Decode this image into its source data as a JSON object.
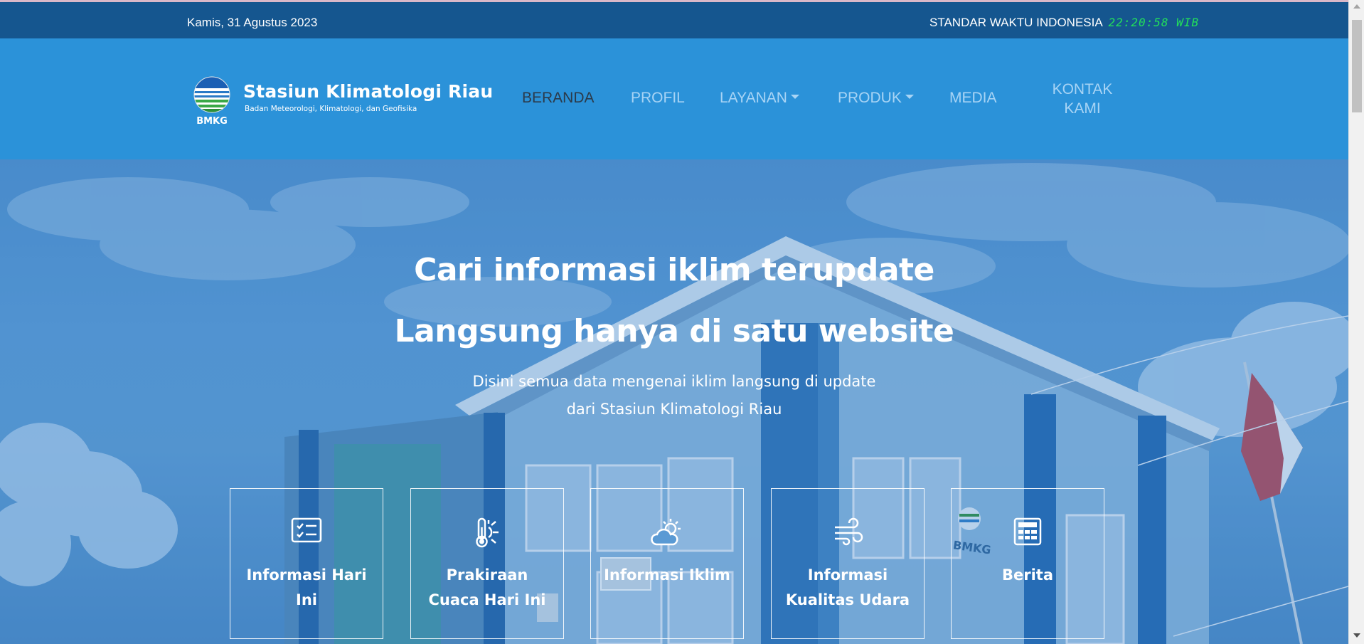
{
  "topbar": {
    "date": "Kamis, 31 Agustus 2023",
    "time_label": "STANDAR WAKTU INDONESIA",
    "clock": "22:20:58 WIB"
  },
  "brand": {
    "logo_text": "BMKG",
    "title": "Stasiun Klimatologi Riau",
    "subtitle": "Badan Meteorologi, Klimatologi, dan Geofisika"
  },
  "nav": {
    "beranda": "BERANDA",
    "profil": "PROFIL",
    "layanan": "LAYANAN",
    "produk": "PRODUK",
    "media": "MEDIA",
    "kontak_line1": "KONTAK",
    "kontak_line2": "KAMI"
  },
  "hero": {
    "title_line1": "Cari informasi iklim terupdate",
    "title_line2": "Langsung hanya di satu website",
    "sub_line1": "Disini semua data mengenai iklim langsung di update",
    "sub_line2": "dari Stasiun Klimatologi Riau",
    "background_building_sign": "BMKG"
  },
  "cards": [
    {
      "line1": "Informasi Hari",
      "line2": "Ini",
      "icon": "checklist-icon"
    },
    {
      "line1": "Prakiraan",
      "line2": "Cuaca Hari Ini",
      "icon": "thermometer-sun-icon"
    },
    {
      "line1": "Informasi Iklim",
      "line2": "",
      "icon": "sun-cloud-icon"
    },
    {
      "line1": "Informasi",
      "line2": "Kualitas Udara",
      "icon": "wind-icon"
    },
    {
      "line1": "Berita",
      "line2": "",
      "icon": "newspaper-icon"
    }
  ],
  "colors": {
    "topbar": "#15568f",
    "header": "#2b92d9",
    "clock": "#22e05a",
    "nav_active": "#2b3a4a",
    "nav_inactive": "#a8d4f5"
  }
}
